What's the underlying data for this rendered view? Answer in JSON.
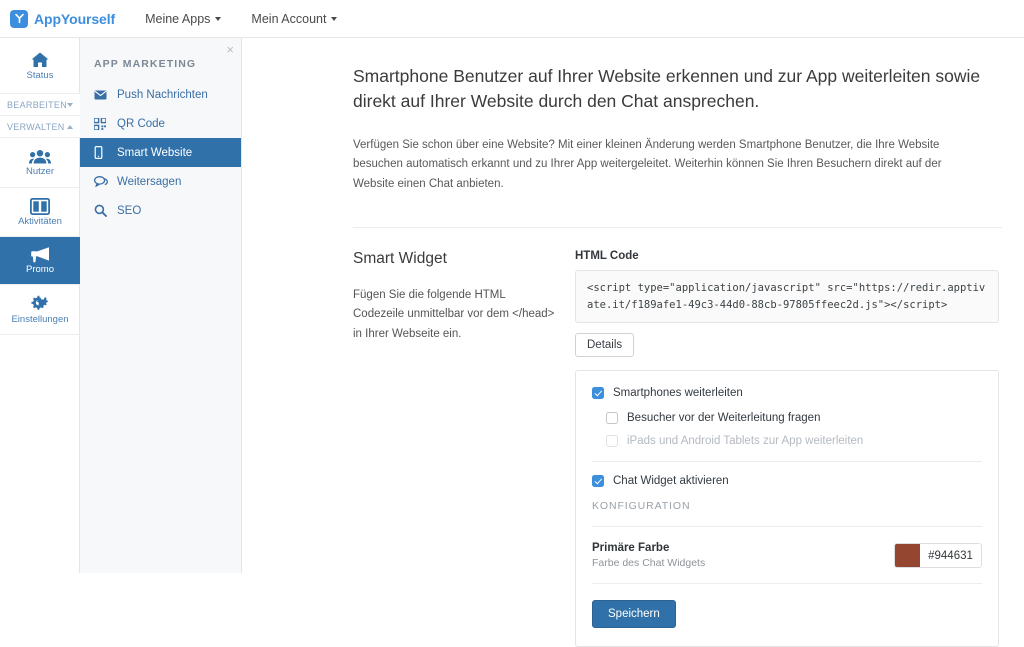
{
  "navbar": {
    "brand": "AppYourself",
    "logo_icon": "appyourself-logo-icon",
    "items": [
      {
        "label": "Meine Apps",
        "icon": "chevron-down-icon"
      },
      {
        "label": "Mein Account",
        "icon": "chevron-down-icon"
      }
    ]
  },
  "icon_rail": {
    "items": [
      {
        "id": "status",
        "label": "Status",
        "icon": "home-icon",
        "active": false
      },
      {
        "id": "nutzer",
        "label": "Nutzer",
        "icon": "users-icon",
        "active": false
      },
      {
        "id": "aktivitaeten",
        "label": "Aktivitäten",
        "icon": "columns-icon",
        "active": false
      },
      {
        "id": "promo",
        "label": "Promo",
        "icon": "megaphone-icon",
        "active": true
      },
      {
        "id": "einstellungen",
        "label": "Einstellungen",
        "icon": "gears-icon",
        "active": false
      }
    ],
    "sections": [
      {
        "id": "bearbeiten",
        "label": "BEARBEITEN",
        "icon": "caret-down-icon",
        "expanded": false
      },
      {
        "id": "verwalten",
        "label": "VERWALTEN",
        "icon": "caret-up-icon",
        "expanded": true
      }
    ]
  },
  "subnav": {
    "title": "APP MARKETING",
    "close_icon": "close-icon",
    "close_label": "×",
    "items": [
      {
        "id": "push-nachrichten",
        "label": "Push Nachrichten",
        "icon": "envelope-icon",
        "active": false
      },
      {
        "id": "qr-code",
        "label": "QR Code",
        "icon": "qrcode-icon",
        "active": false
      },
      {
        "id": "smart-website",
        "label": "Smart Website",
        "icon": "mobile-phone-icon",
        "active": true
      },
      {
        "id": "weitersagen",
        "label": "Weitersagen",
        "icon": "comments-icon",
        "active": false
      },
      {
        "id": "seo",
        "label": "SEO",
        "icon": "search-icon",
        "active": false
      }
    ]
  },
  "main": {
    "title": "Smartphone Benutzer auf Ihrer Website erkennen und zur App weiterleiten sowie direkt auf Ihrer Website durch den Chat ansprechen.",
    "description": "Verfügen Sie schon über eine Website? Mit einer kleinen Änderung werden Smartphone Benutzer, die Ihre Website besuchen automatisch erkannt und zu Ihrer App weitergeleitet. Weiterhin können Sie Ihren Besuchern direkt auf der Website einen Chat anbieten.",
    "smart_widget": {
      "heading": "Smart Widget",
      "description": "Fügen Sie die folgende HTML Codezeile unmittelbar vor dem </head> in Ihrer Webseite ein."
    },
    "html_code": {
      "label": "HTML Code",
      "value": "<script type=\"application/javascript\" src=\"https://redir.apptivate.it/f189afe1-49c3-44d0-88cb-97805ffeec2d.js\"></script>",
      "details_button": "Details"
    },
    "options": {
      "checkboxes": [
        {
          "id": "smartphones-weiterleiten",
          "label": "Smartphones weiterleiten",
          "checked": true,
          "disabled": false,
          "sub": false
        },
        {
          "id": "besucher-fragen",
          "label": "Besucher vor der Weiterleitung fragen",
          "checked": false,
          "disabled": false,
          "sub": true
        },
        {
          "id": "tablets-weiterleiten",
          "label": "iPads und Android Tablets zur App weiterleiten",
          "checked": false,
          "disabled": true,
          "sub": true
        },
        {
          "id": "chat-widget-aktivieren",
          "label": "Chat Widget aktivieren",
          "checked": true,
          "disabled": false,
          "sub": false
        }
      ],
      "config_heading": "KONFIGURATION",
      "color_setting": {
        "name": "Primäre Farbe",
        "sublabel": "Farbe des Chat Widgets",
        "value": "#944631",
        "swatch_color": "#944631"
      },
      "save_button": "Speichern"
    }
  },
  "colors": {
    "accent_blue": "#3071a9",
    "brand_blue": "#3e8ede",
    "primary_color": "#944631"
  }
}
